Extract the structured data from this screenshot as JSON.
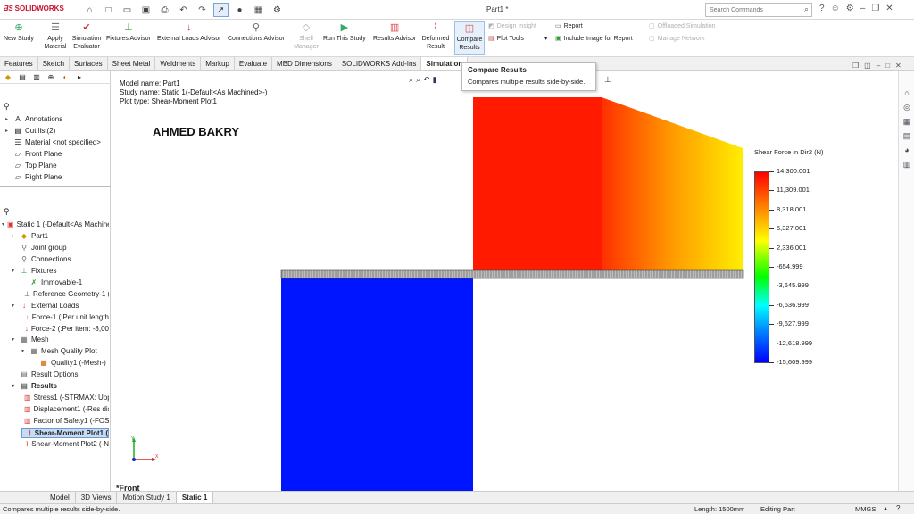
{
  "app": {
    "logo_brand": "SOLIDWORKS",
    "document_title": "Part1 *",
    "search_placeholder": "Search Commands"
  },
  "ribbon": {
    "new_study": "New Study",
    "apply_material": "Apply Material",
    "simulation_evaluator": "Simulation Evaluator",
    "fixtures_advisor": "Fixtures Advisor",
    "external_loads_advisor": "External Loads Advisor",
    "connections_advisor": "Connections Advisor",
    "shell_manager": "Shell Manager",
    "run_this_study": "Run This Study",
    "results_advisor": "Results Advisor",
    "deformed_result": "Deformed Result",
    "compare_results": "Compare Results",
    "design_insight": "Design Insight",
    "plot_tools": "Plot Tools",
    "report": "Report",
    "include_image": "Include Image for Report",
    "offloaded_simulation": "Offloaded Simulation",
    "manage_network": "Manage Network"
  },
  "tabs": [
    "Features",
    "Sketch",
    "Surfaces",
    "Sheet Metal",
    "Weldments",
    "Markup",
    "Evaluate",
    "MBD Dimensions",
    "SOLIDWORKS Add-Ins",
    "Simulation"
  ],
  "tooltip": {
    "title": "Compare Results",
    "description": "Compares multiple results side-by-side."
  },
  "feature_tree": [
    {
      "label": "Annotations",
      "icon": "annotations-icon"
    },
    {
      "label": "Cut list(2)",
      "icon": "cutlist-icon"
    },
    {
      "label": "Material <not specified>",
      "icon": "material-icon"
    },
    {
      "label": "Front Plane",
      "icon": "plane-icon"
    },
    {
      "label": "Top Plane",
      "icon": "plane-icon"
    },
    {
      "label": "Right Plane",
      "icon": "plane-icon"
    }
  ],
  "study_tree": [
    {
      "label": "Static 1 (-Default<As Machined>-)",
      "indent": 0
    },
    {
      "label": "Part1",
      "indent": 1
    },
    {
      "label": "Joint group",
      "indent": 1
    },
    {
      "label": "Connections",
      "indent": 1
    },
    {
      "label": "Fixtures",
      "indent": 1
    },
    {
      "label": "Immovable-1",
      "indent": 2
    },
    {
      "label": "Reference Geometry-1 (",
      "indent": 2
    },
    {
      "label": "External Loads",
      "indent": 1
    },
    {
      "label": "Force-1 (:Per unit length",
      "indent": 2
    },
    {
      "label": "Force-2 (:Per item: -8,00",
      "indent": 2
    },
    {
      "label": "Mesh",
      "indent": 1
    },
    {
      "label": "Mesh Quality Plot",
      "indent": 2
    },
    {
      "label": "Quality1 (-Mesh-)",
      "indent": 3
    },
    {
      "label": "Result Options",
      "indent": 1
    },
    {
      "label": "Results",
      "indent": 1
    },
    {
      "label": "Stress1 (-STRMAX: Uppe",
      "indent": 2
    },
    {
      "label": "Displacement1 (-Res dis",
      "indent": 2
    },
    {
      "label": "Factor of Safety1 (-FOS-",
      "indent": 2
    },
    {
      "label": "Shear-Moment Plot1 (",
      "indent": 2
    },
    {
      "label": "Shear-Moment Plot2 (-N",
      "indent": 2
    }
  ],
  "plot_info": {
    "model_name": "Model name: Part1",
    "study_name": "Study name: Static 1(-Default<As Machined>-)",
    "plot_type": "Plot type:  Shear-Moment Plot1"
  },
  "watermark": "AHMED BAKRY",
  "legend": {
    "title": "Shear Force in Dir2 (N)",
    "values": [
      "14,300.001",
      "11,309.001",
      "8,318.001",
      "5,327.001",
      "2,336.001",
      "-654.999",
      "-3,645.999",
      "-6,636.999",
      "-9,627.999",
      "-12,618.999",
      "-15,609.999"
    ]
  },
  "view_label": "*Front",
  "bottom_tabs": [
    "Model",
    "3D Views",
    "Motion Study 1",
    "Static 1"
  ],
  "status": {
    "message": "Compares multiple results side-by-side.",
    "length": "Length: 1500mm",
    "mode": "Editing Part",
    "units": "MMGS"
  },
  "colors": {
    "accent": "#c8102e",
    "selection": "#c7dcf4"
  }
}
